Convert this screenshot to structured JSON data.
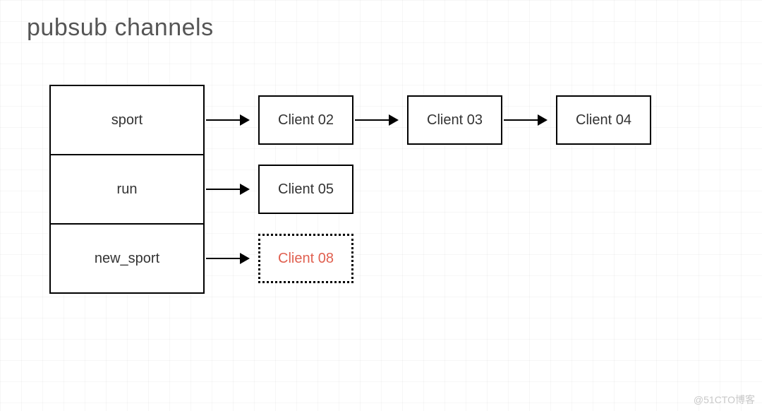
{
  "title": "pubsub channels",
  "channels": {
    "sport": {
      "label": "sport",
      "subscribers": [
        "Client 02",
        "Client 03",
        "Client 04"
      ]
    },
    "run": {
      "label": "run",
      "subscribers": [
        "Client 05"
      ]
    },
    "new_sport": {
      "label": "new_sport",
      "subscribers": [
        "Client 08"
      ],
      "new": true
    }
  },
  "watermark": "@51CTO博客",
  "chart_data": {
    "type": "diagram",
    "description": "pubsub_channels map: each channel key points to a linked list of subscriber clients",
    "nodes": [
      {
        "id": "sport",
        "kind": "channel",
        "label": "sport"
      },
      {
        "id": "run",
        "kind": "channel",
        "label": "run"
      },
      {
        "id": "new_sport",
        "kind": "channel",
        "label": "new_sport"
      },
      {
        "id": "c02",
        "kind": "client",
        "label": "Client 02"
      },
      {
        "id": "c03",
        "kind": "client",
        "label": "Client 03"
      },
      {
        "id": "c04",
        "kind": "client",
        "label": "Client 04"
      },
      {
        "id": "c05",
        "kind": "client",
        "label": "Client 05"
      },
      {
        "id": "c08",
        "kind": "client",
        "label": "Client 08",
        "highlight": true,
        "dashed": true
      }
    ],
    "edges": [
      {
        "from": "sport",
        "to": "c02"
      },
      {
        "from": "c02",
        "to": "c03"
      },
      {
        "from": "c03",
        "to": "c04"
      },
      {
        "from": "run",
        "to": "c05"
      },
      {
        "from": "new_sport",
        "to": "c08"
      }
    ]
  }
}
